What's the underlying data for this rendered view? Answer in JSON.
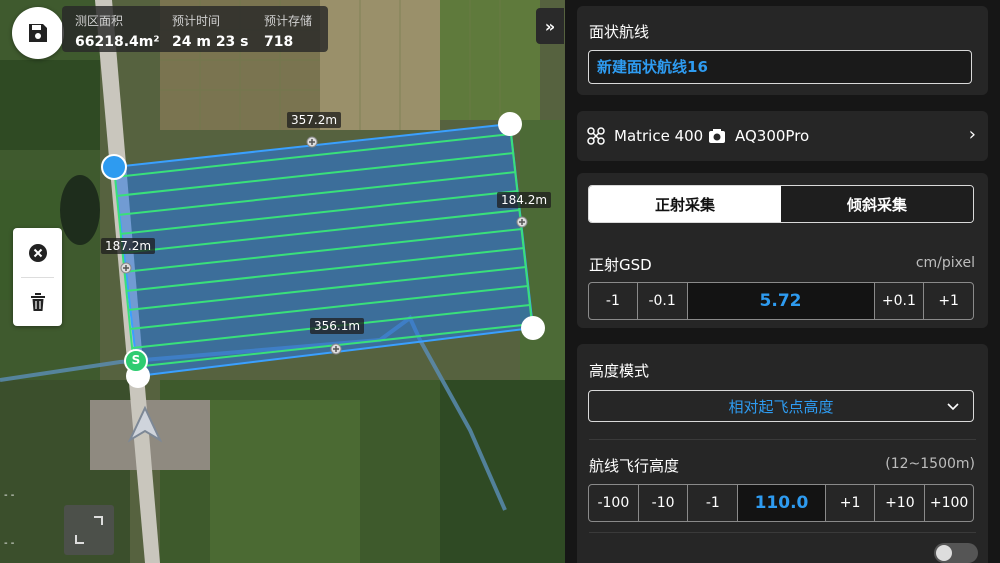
{
  "stats": [
    {
      "label": "测区面积",
      "value": "66218.4m²"
    },
    {
      "label": "预计时间",
      "value": "24 m 23 s"
    },
    {
      "label": "预计存储",
      "value": "718"
    }
  ],
  "map": {
    "distances": [
      "357.2m",
      "184.2m",
      "187.2m",
      "356.1m"
    ],
    "start_marker": "S",
    "scale_marks": [
      "- -",
      "- -"
    ]
  },
  "route_name": {
    "label": "面状航线",
    "value": "新建面状航线16"
  },
  "device": {
    "drone": "Matrice 400",
    "camera": "AQ300Pro"
  },
  "capture_modes": {
    "active": "正射采集",
    "inactive": "倾斜采集"
  },
  "gsd": {
    "label": "正射GSD",
    "unit": "cm/pixel",
    "buttons": [
      "-1",
      "-0.1",
      "+0.1",
      "+1"
    ],
    "value": "5.72"
  },
  "altitude_mode": {
    "label": "高度模式",
    "value": "相对起飞点高度"
  },
  "flight_height": {
    "label": "航线飞行高度",
    "range": "(12~1500m)",
    "buttons": [
      "-100",
      "-10",
      "-1",
      "+1",
      "+10",
      "+100"
    ],
    "value": "110.0"
  },
  "colors": {
    "accent": "#2e9bf0",
    "route_line": "#39e07a",
    "polygon_edge": "#3aa0ff"
  }
}
